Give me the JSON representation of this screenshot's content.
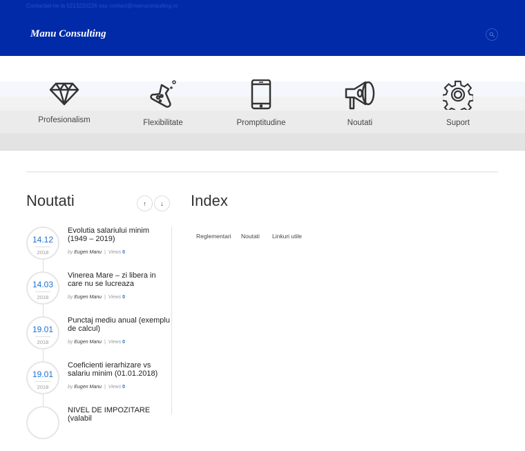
{
  "header": {
    "contact": "Contactati-ne la 0213220226 sau contact@manuconsulting.ro",
    "logo": "Manu Consulting",
    "search_icon": "search-icon"
  },
  "features": [
    {
      "label": "Profesionalism",
      "icon": "diamond-icon"
    },
    {
      "label": "Flexibilitate",
      "icon": "flask-icon"
    },
    {
      "label": "Promptitudine",
      "icon": "smartphone-icon"
    },
    {
      "label": "Noutati",
      "icon": "megaphone-icon"
    },
    {
      "label": "Suport",
      "icon": "gear-icon"
    }
  ],
  "news": {
    "heading": "Noutati",
    "up": "↑",
    "down": "↓",
    "items": [
      {
        "day": "14.12",
        "year": "2018",
        "title": "Evolutia salariului minim (1949 – 2019)",
        "by": "by",
        "author": "Eugen Manu",
        "sep": "|",
        "views_label": "Views",
        "views": "0"
      },
      {
        "day": "14.03",
        "year": "2018",
        "title": "Vinerea Mare – zi libera in care nu se lucreaza",
        "by": "by",
        "author": "Eugen Manu",
        "sep": "|",
        "views_label": "Views",
        "views": "0"
      },
      {
        "day": "19.01",
        "year": "2018",
        "title": "Punctaj mediu anual (exemplu de calcul)",
        "by": "by",
        "author": "Eugen Manu",
        "sep": "|",
        "views_label": "Views",
        "views": "0"
      },
      {
        "day": "19.01",
        "year": "2018",
        "title": "Coeficienti ierarhizare vs salariu minim (01.01.2018)",
        "by": "by",
        "author": "Eugen Manu",
        "sep": "|",
        "views_label": "Views",
        "views": "0"
      },
      {
        "day": "",
        "year": "",
        "title": "NIVEL DE IMPOZITARE (valabil",
        "by": "",
        "author": "",
        "sep": "",
        "views_label": "",
        "views": ""
      }
    ]
  },
  "index": {
    "heading": "Index",
    "tabs": [
      "Reglementari",
      "Noutati",
      "Linkuri utile"
    ]
  }
}
